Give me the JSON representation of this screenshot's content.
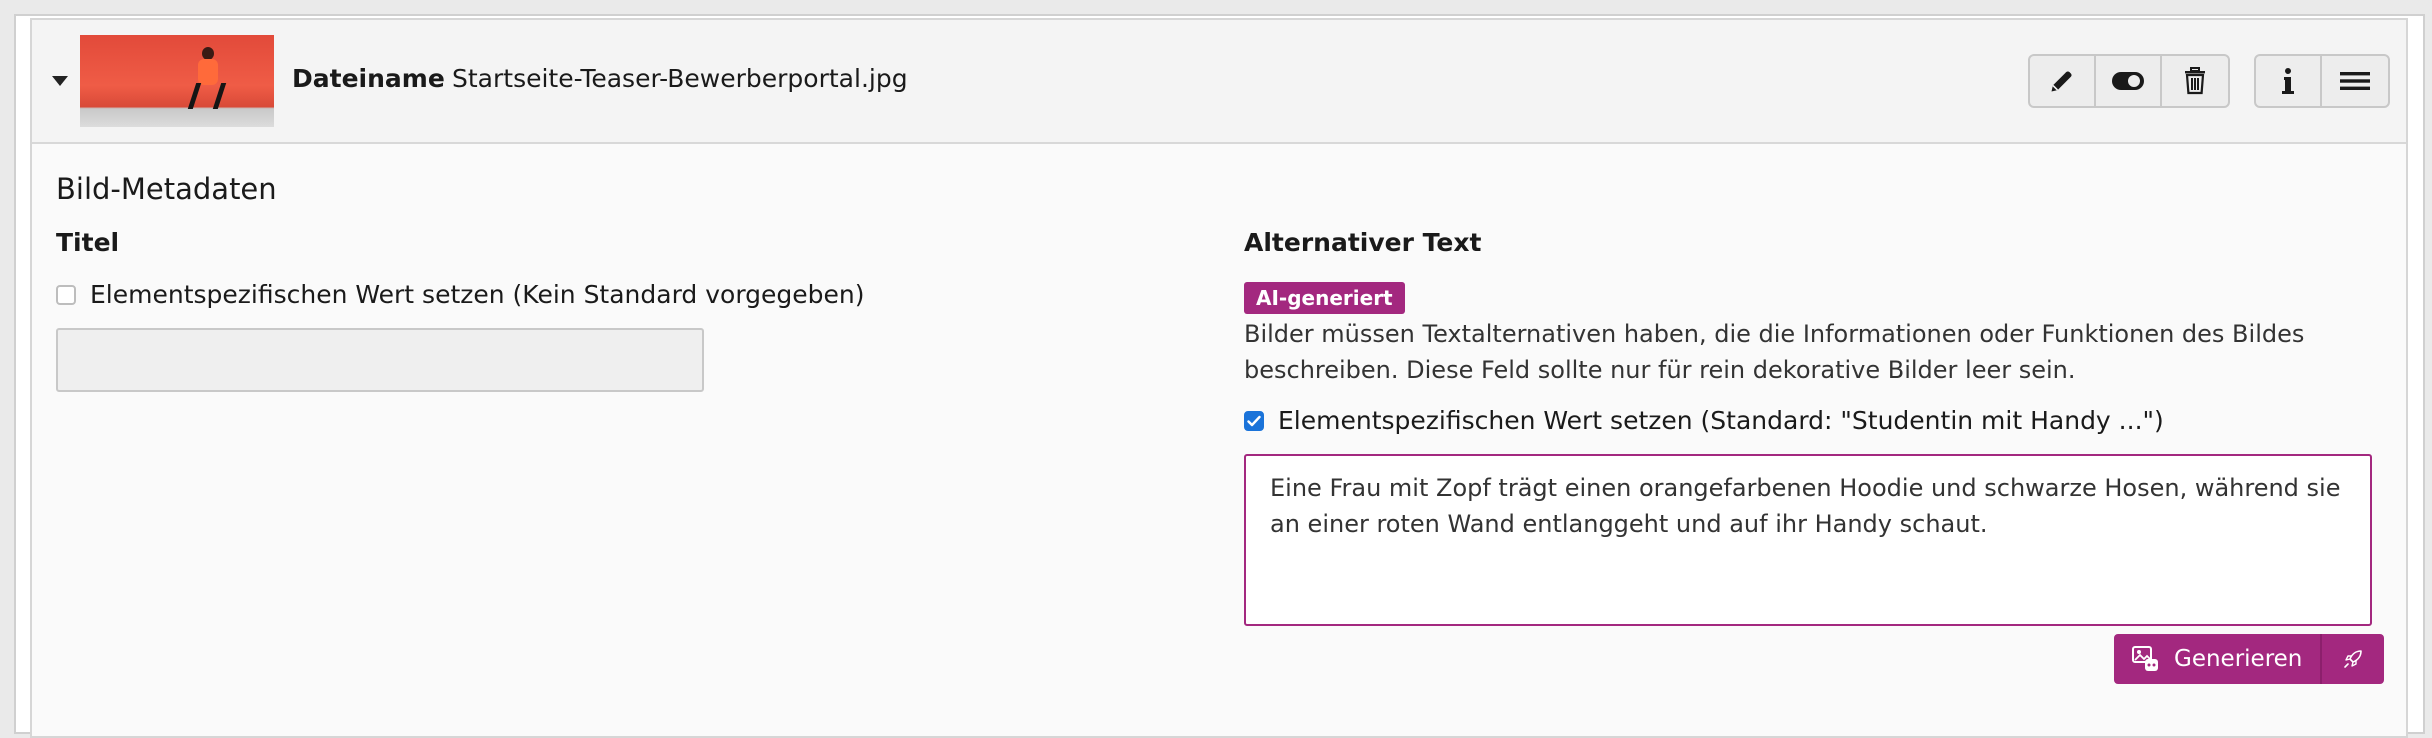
{
  "file": {
    "name_label": "Dateiname",
    "name_value": "Startseite-Teaser-Bewerberportal.jpg"
  },
  "toolbar": {
    "icons": [
      "pencil-icon",
      "toggle-icon",
      "trash-icon",
      "info-icon",
      "menu-icon"
    ]
  },
  "section": {
    "title": "Bild-Metadaten"
  },
  "title_field": {
    "label": "Titel",
    "checkbox_label": "Elementspezifischen Wert setzen (Kein Standard vorgegeben)",
    "checked": false,
    "value": ""
  },
  "alt_field": {
    "label": "Alternativer Text",
    "badge": "AI-generiert",
    "help": "Bilder müssen Textalternativen haben, die die Informationen oder Funktionen des Bildes beschreiben. Diese Feld sollte nur für rein dekorative Bilder leer sein.",
    "checkbox_label": "Elementspezifischen Wert setzen (Standard: \"Studentin mit Handy ...\")",
    "checked": true,
    "value": "Eine Frau mit Zopf trägt einen orangefarbenen Hoodie und schwarze Hosen, während sie an einer roten Wand entlanggeht und auf ihr Handy schaut.",
    "generate_label": "Generieren"
  },
  "colors": {
    "accent": "#a3287f",
    "checkbox": "#1a73d9"
  }
}
